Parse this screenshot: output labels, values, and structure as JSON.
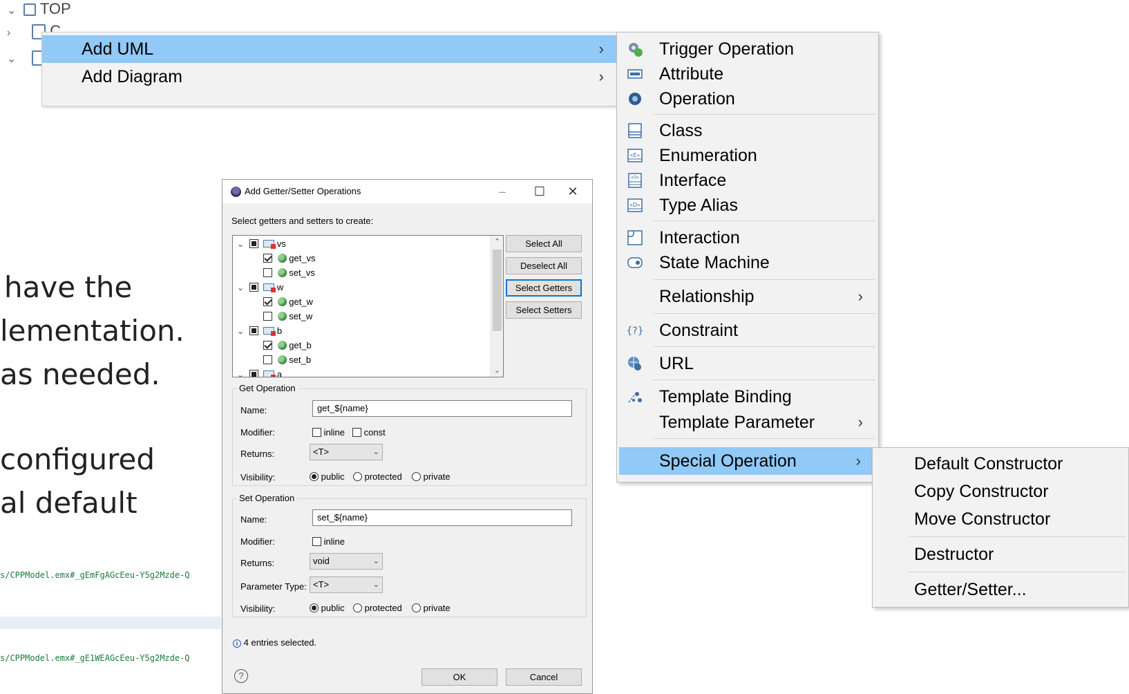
{
  "background": {
    "tree": [
      {
        "label": "TOP"
      },
      {
        "label": "C"
      }
    ],
    "slide_lines": [
      "have the",
      "lementation.",
      "as needed.",
      "configured",
      "al default"
    ],
    "code_lines": [
      "s/CPPModel.emx#_gEmFgAGcEeu-Y5g2Mzde-Q",
      "s/CPPModel.emx#_gE1WEAGcEeu-Y5g2Mzde-Q"
    ]
  },
  "context_menu": {
    "items": [
      {
        "label": "Add UML",
        "arrow": "›",
        "selected": true
      },
      {
        "label": "Add Diagram",
        "arrow": "›",
        "selected": false
      }
    ]
  },
  "add_uml_menu": {
    "items": [
      {
        "label": "Trigger Operation",
        "icon": "trigger-operation-icon"
      },
      {
        "label": "Attribute",
        "icon": "attribute-icon"
      },
      {
        "label": "Operation",
        "icon": "operation-icon"
      },
      {
        "label": "Class",
        "icon": "class-icon"
      },
      {
        "label": "Enumeration",
        "icon": "enumeration-icon"
      },
      {
        "label": "Interface",
        "icon": "interface-icon"
      },
      {
        "label": "Type Alias",
        "icon": "type-alias-icon"
      },
      {
        "label": "Interaction",
        "icon": "interaction-icon"
      },
      {
        "label": "State Machine",
        "icon": "state-machine-icon"
      },
      {
        "label": "Relationship",
        "arrow": "›"
      },
      {
        "label": "Constraint",
        "icon": "constraint-icon"
      },
      {
        "label": "URL",
        "icon": "url-icon"
      },
      {
        "label": "Template Binding",
        "icon": "template-binding-icon"
      },
      {
        "label": "Template Parameter",
        "arrow": "›"
      },
      {
        "label": "Special Operation",
        "arrow": "›",
        "selected": true
      }
    ]
  },
  "special_operation_menu": {
    "items": [
      "Default Constructor",
      "Copy Constructor",
      "Move Constructor",
      "Destructor",
      "Getter/Setter..."
    ]
  },
  "dialog": {
    "title": "Add Getter/Setter Operations",
    "instruction": "Select getters and setters to create:",
    "tree": [
      {
        "label": "vs",
        "children": [
          {
            "label": "get_vs",
            "checked": true
          },
          {
            "label": "set_vs",
            "checked": false
          }
        ]
      },
      {
        "label": "w",
        "children": [
          {
            "label": "get_w",
            "checked": true
          },
          {
            "label": "set_w",
            "checked": false
          }
        ]
      },
      {
        "label": "b",
        "children": [
          {
            "label": "get_b",
            "checked": true
          },
          {
            "label": "set_b",
            "checked": false
          }
        ]
      },
      {
        "label": "a"
      }
    ],
    "buttons": {
      "select_all": "Select All",
      "deselect_all": "Deselect All",
      "select_getters": "Select Getters",
      "select_setters": "Select Setters",
      "ok": "OK",
      "cancel": "Cancel"
    },
    "get_operation": {
      "group_title": "Get Operation",
      "name_label": "Name:",
      "name_value": "get_${name}",
      "modifier_label": "Modifier:",
      "inline_label": "inline",
      "const_label": "const",
      "inline_checked": false,
      "const_checked": false,
      "returns_label": "Returns:",
      "returns_value": "<T>",
      "visibility_label": "Visibility:",
      "visibility_options": [
        "public",
        "protected",
        "private"
      ],
      "visibility_selected": "public"
    },
    "set_operation": {
      "group_title": "Set Operation",
      "name_label": "Name:",
      "name_value": "set_${name}",
      "modifier_label": "Modifier:",
      "inline_label": "inline",
      "inline_checked": false,
      "returns_label": "Returns:",
      "returns_value": "void",
      "param_type_label": "Parameter Type:",
      "param_type_value": "<T>",
      "visibility_label": "Visibility:",
      "visibility_options": [
        "public",
        "protected",
        "private"
      ],
      "visibility_selected": "public"
    },
    "status": "4 entries selected.",
    "help_glyph": "?",
    "info_glyph": "i"
  },
  "colors": {
    "menu_selection": "#91c9f7",
    "focus_border": "#0078d7",
    "dialog_bg": "#f0f0f0"
  }
}
